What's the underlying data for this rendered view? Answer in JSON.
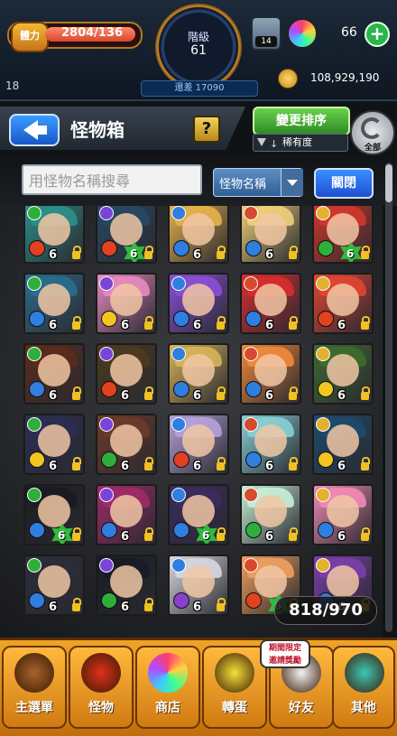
{
  "status": {
    "stamina_label": "體力",
    "stamina": "2804/136",
    "rank_label": "階級",
    "rank_value": "61",
    "rank_remain": "還差 17090",
    "box_expansion_count": "14",
    "orb_count": "66",
    "orb_add": "+",
    "level_text": "18",
    "coins": "108,929,190"
  },
  "header": {
    "title": "怪物箱",
    "help": "?",
    "sort_button": "變更排序",
    "sort_field": "稀有度",
    "all_label": "全部"
  },
  "search": {
    "placeholder": "用怪物名稱搜尋",
    "type_selected": "怪物名稱",
    "close_button": "關閉"
  },
  "box_counter": "818/970",
  "grid": {
    "cards": [
      {
        "lv": "6",
        "badge": false,
        "elem": "fire",
        "hair": "#2c8f8a"
      },
      {
        "lv": "6",
        "badge": true,
        "elem": "fire",
        "hair": "#274862"
      },
      {
        "lv": "6",
        "badge": false,
        "elem": "water",
        "hair": "#e6b34b"
      },
      {
        "lv": "6",
        "badge": false,
        "elem": "water",
        "hair": "#f0d07a"
      },
      {
        "lv": "6",
        "badge": true,
        "elem": "wood",
        "hair": "#d1362c"
      },
      {
        "lv": "6",
        "badge": false,
        "elem": "water",
        "hair": "#2a6d8c"
      },
      {
        "lv": "6",
        "badge": false,
        "elem": "light",
        "hair": "#e88ac0"
      },
      {
        "lv": "6",
        "badge": false,
        "elem": "water",
        "hair": "#8a4fd6"
      },
      {
        "lv": "6",
        "badge": false,
        "elem": "water",
        "hair": "#d72e2e"
      },
      {
        "lv": "6",
        "badge": false,
        "elem": "fire",
        "hair": "#e24532"
      },
      {
        "lv": "6",
        "badge": false,
        "elem": "water",
        "hair": "#5a2b1c"
      },
      {
        "lv": "6",
        "badge": false,
        "elem": "fire",
        "hair": "#4b3a1f"
      },
      {
        "lv": "6",
        "badge": false,
        "elem": "water",
        "hair": "#d8b45a"
      },
      {
        "lv": "6",
        "badge": false,
        "elem": "water",
        "hair": "#f18a3c"
      },
      {
        "lv": "6",
        "badge": false,
        "elem": "light",
        "hair": "#3d6b2f"
      },
      {
        "lv": "6",
        "badge": false,
        "elem": "light",
        "hair": "#2b2e52"
      },
      {
        "lv": "6",
        "badge": false,
        "elem": "wood",
        "hair": "#6c3b2a"
      },
      {
        "lv": "6",
        "badge": false,
        "elem": "fire",
        "hair": "#b6a3d9"
      },
      {
        "lv": "6",
        "badge": false,
        "elem": "water",
        "hair": "#8ad0d7"
      },
      {
        "lv": "6",
        "badge": false,
        "elem": "light",
        "hair": "#1d4a6b"
      },
      {
        "lv": "6",
        "badge": true,
        "elem": "water",
        "hair": "#1b1c22"
      },
      {
        "lv": "6",
        "badge": false,
        "elem": "water",
        "hair": "#a02a68"
      },
      {
        "lv": "6",
        "badge": true,
        "elem": "water",
        "hair": "#3a2b5c"
      },
      {
        "lv": "6",
        "badge": false,
        "elem": "wood",
        "hair": "#c9f0d8"
      },
      {
        "lv": "6",
        "badge": false,
        "elem": "water",
        "hair": "#f28bb6"
      },
      {
        "lv": "6",
        "badge": false,
        "elem": "water",
        "hair": "#2a2c38"
      },
      {
        "lv": "6",
        "badge": false,
        "elem": "wood",
        "hair": "#171c24"
      },
      {
        "lv": "6",
        "badge": false,
        "elem": "dark",
        "hair": "#d8d8e0"
      },
      {
        "lv": "6",
        "badge": true,
        "elem": "fire",
        "hair": "#f0a060"
      },
      {
        "lv": "6",
        "badge": false,
        "elem": "water",
        "hair": "#7b3fa8"
      }
    ]
  },
  "nav": {
    "items": [
      {
        "label": "主選單",
        "icon": "home-icon",
        "color": "#a8632b"
      },
      {
        "label": "怪物",
        "icon": "monster-icon",
        "color": "#e0311a"
      },
      {
        "label": "商店",
        "icon": "orb-icon",
        "color": "#7a2fd8"
      },
      {
        "label": "轉蛋",
        "icon": "gacha-icon",
        "color": "#f7e23a"
      },
      {
        "label": "好友",
        "icon": "friends-icon",
        "color": "#f2f2f2"
      },
      {
        "label": "其他",
        "icon": "other-icon",
        "color": "#3ec7b8"
      }
    ],
    "friend_banner": "期間限定\n邀請獎勵"
  }
}
